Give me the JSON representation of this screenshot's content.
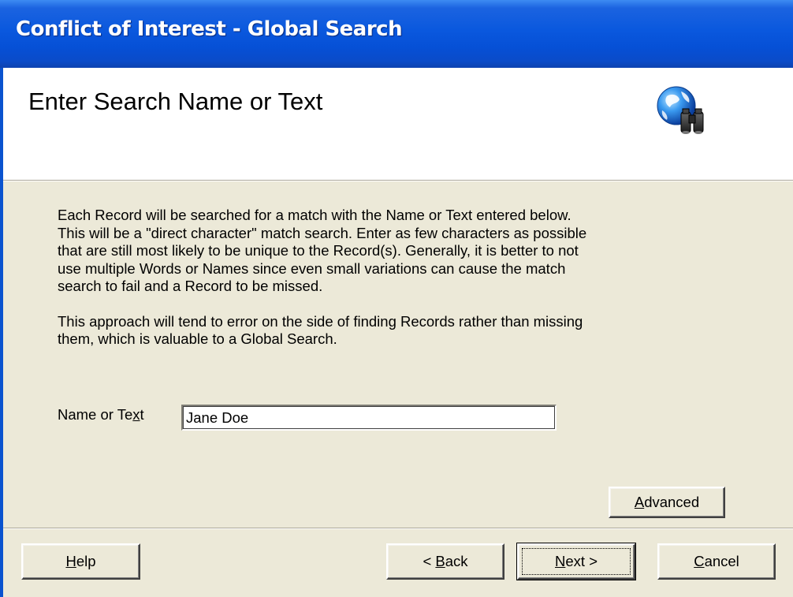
{
  "window": {
    "title": "Conflict of Interest - Global Search"
  },
  "header": {
    "title": "Enter Search Name or Text",
    "icon": "globe-binoculars-icon"
  },
  "description": {
    "paragraph1": "Each Record will be searched for a match with the Name or Text entered below.\nThis will be a \"direct character\" match search.  Enter as few characters as possible\nthat are still most likely to be unique to the Record(s).   Generally, it is better to not\nuse multiple Words or Names since even small variations can cause the match\nsearch to fail and a Record to be missed.",
    "paragraph2": "This approach will tend to error on the side of finding Records rather than missing\nthem, which is valuable to a Global Search."
  },
  "search": {
    "label_before": "Name or Te",
    "label_accel": "x",
    "label_after": "t",
    "value": "Jane Doe"
  },
  "buttons": {
    "advanced": {
      "accel": "A",
      "rest": "dvanced"
    },
    "help": {
      "accel": "H",
      "rest": "elp"
    },
    "back": {
      "prefix": "< ",
      "accel": "B",
      "rest": "ack"
    },
    "next": {
      "accel": "N",
      "rest": "ext >"
    },
    "cancel": {
      "accel": "C",
      "rest": "ancel"
    }
  },
  "colors": {
    "titlebar": "#0a58de",
    "face": "#ece9d8",
    "header_bg": "#ffffff"
  }
}
